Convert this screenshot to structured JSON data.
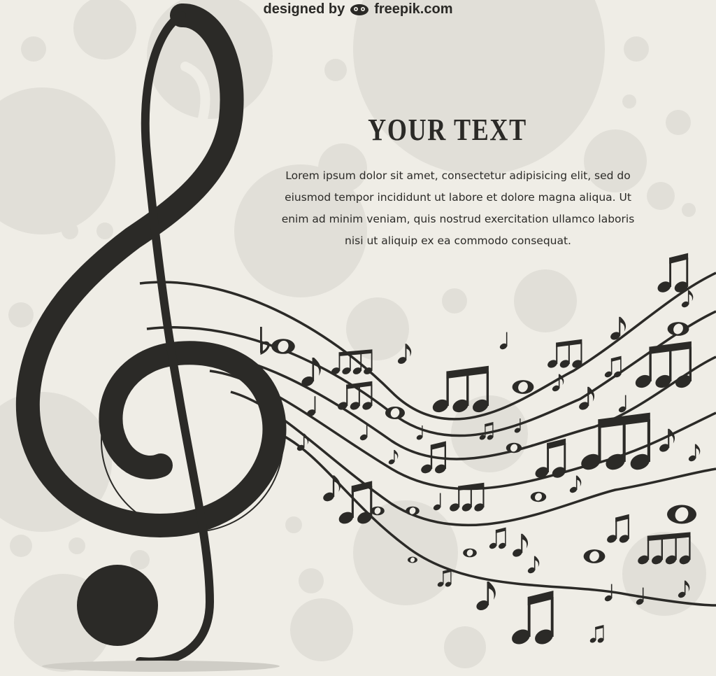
{
  "credit": {
    "prefix": "designed by",
    "brand": "freepik.com",
    "logo_icon": "freepik-mascot-icon"
  },
  "headline": "YOUR TEXT",
  "body_text": "Lorem ipsum dolor sit amet, consectetur adipisicing elit, sed do eiusmod tempor incididunt ut labore et dolore magna aliqua. Ut enim ad minim veniam, quis nostrud exercitation ullamco laboris nisi ut aliquip ex ea commodo consequat.",
  "colors": {
    "background": "#efede6",
    "bubble": "#e2e0d9",
    "ink": "#2b2a27"
  },
  "icons": [
    "treble-clef-icon",
    "music-note-icon",
    "beamed-notes-icon",
    "whole-note-icon",
    "flat-sign-icon"
  ]
}
